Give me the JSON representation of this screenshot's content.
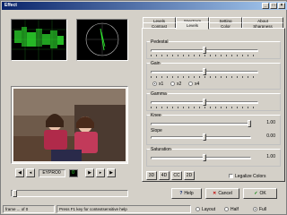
{
  "window": {
    "title": "Effect"
  },
  "tabs_row1": [
    {
      "label": "Levels"
    },
    {
      "label": "Spectrum"
    },
    {
      "label": "Setting"
    },
    {
      "label": "About"
    }
  ],
  "tabs_row2": [
    {
      "label": "Contrast"
    },
    {
      "label": "Levels"
    },
    {
      "label": "Color"
    },
    {
      "label": "Sharpness"
    }
  ],
  "params": {
    "pedestal": {
      "label": "Pedestal"
    },
    "gain": {
      "label": "Gain"
    },
    "radio": [
      {
        "label": "x1"
      },
      {
        "label": "x2"
      },
      {
        "label": "x4"
      }
    ],
    "gamma": {
      "label": "Gamma"
    },
    "knee": {
      "label": "Knee",
      "value": "1.00"
    },
    "slope": {
      "label": "Slope",
      "value": "0.00"
    },
    "saturation": {
      "label": "Saturation",
      "value": "1.00"
    }
  },
  "legalize": {
    "label": "Legalize Colors",
    "checked": false
  },
  "transport": {
    "timecode": "EYPRO0",
    "counter": "0"
  },
  "adv_buttons": [
    {
      "label": "3D"
    },
    {
      "label": "4D"
    },
    {
      "label": "CC"
    },
    {
      "label": "2D"
    }
  ],
  "actions": {
    "help": "Help",
    "cancel": "Cancel",
    "ok": "OK"
  },
  "status": {
    "frame": "frame ... of 0",
    "hint": "Press F1 key for contextsensitive help",
    "opt1": "Layout",
    "opt2": "Half",
    "opt3": "Full"
  },
  "colors": {
    "titlebar": "#0a246a",
    "scope_trace": "#2fe62f"
  }
}
